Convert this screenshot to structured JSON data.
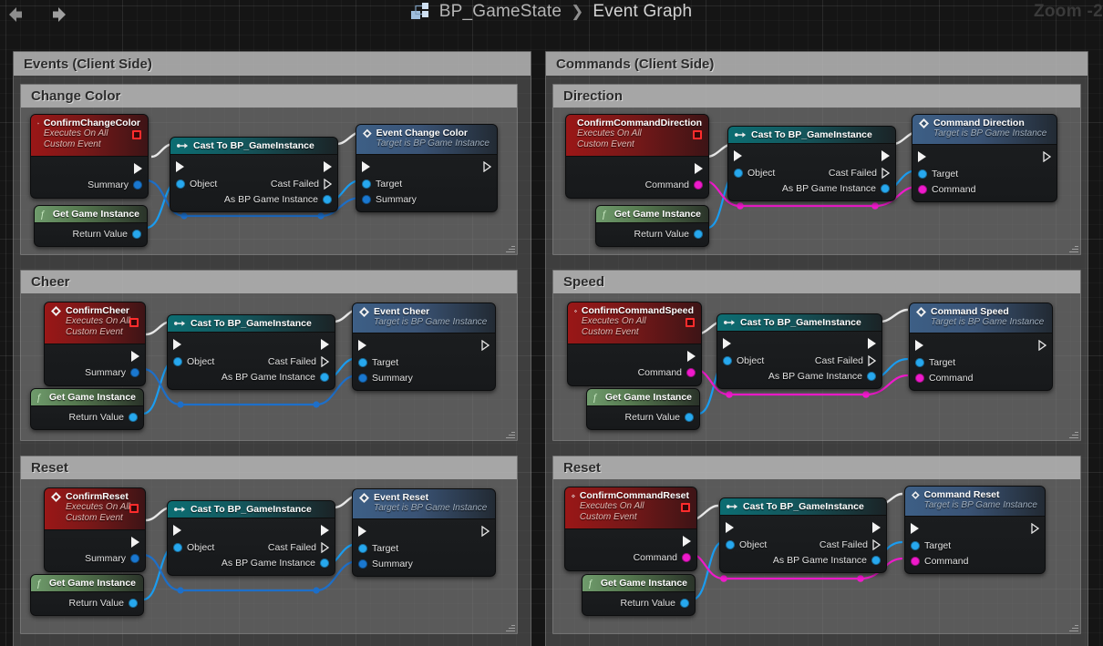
{
  "window": {
    "title": "BP_GameState",
    "subtitle": "Event Graph",
    "separator": "❯",
    "zoom_label": "Zoom -2",
    "blueprint_icon": "blueprint-icon",
    "back_icon": "back-arrow-icon",
    "forward_icon": "forward-arrow-icon"
  },
  "comments": {
    "events_client": "Events (Client Side)",
    "commands_client": "Commands (Client Side)",
    "change_color": "Change Color",
    "cheer": "Cheer",
    "reset_left": "Reset",
    "direction": "Direction",
    "speed": "Speed",
    "reset_right": "Reset"
  },
  "labels": {
    "executes_on_all": "Executes On All",
    "custom_event": "Custom Event",
    "target_is_bp_game_instance": "Target is BP Game Instance",
    "cast_title": "Cast To BP_GameInstance",
    "get_game_instance": "Get Game Instance",
    "return_value": "Return Value",
    "object": "Object",
    "cast_failed": "Cast Failed",
    "as_bp_game_instance": "As BP Game Instance",
    "summary": "Summary",
    "target": "Target",
    "command": "Command"
  },
  "nodes": {
    "confirm_change_color": "ConfirmChangeColor",
    "event_change_color": "Event Change Color",
    "confirm_cheer": "ConfirmCheer",
    "event_cheer": "Event Cheer",
    "confirm_reset": "ConfirmReset",
    "event_reset": "Event Reset",
    "confirm_command_direction": "ConfirmCommandDirection",
    "command_direction": "Command Direction",
    "confirm_command_speed": "ConfirmCommandSpeed",
    "command_speed": "Command Speed",
    "confirm_command_reset": "ConfirmCommandReset",
    "command_reset": "Command Reset"
  },
  "colors": {
    "exec_pin": "#f2f2f2",
    "object_pin": "#27a8ee",
    "string_pin": "#ef1acb",
    "event_header": "#9a1717",
    "cast_header": "#0c6d72",
    "dispatch_header": "#3d5f86",
    "function_header": "#6f9b6c",
    "canvas": "#151515",
    "comment_fill": "#808080"
  }
}
